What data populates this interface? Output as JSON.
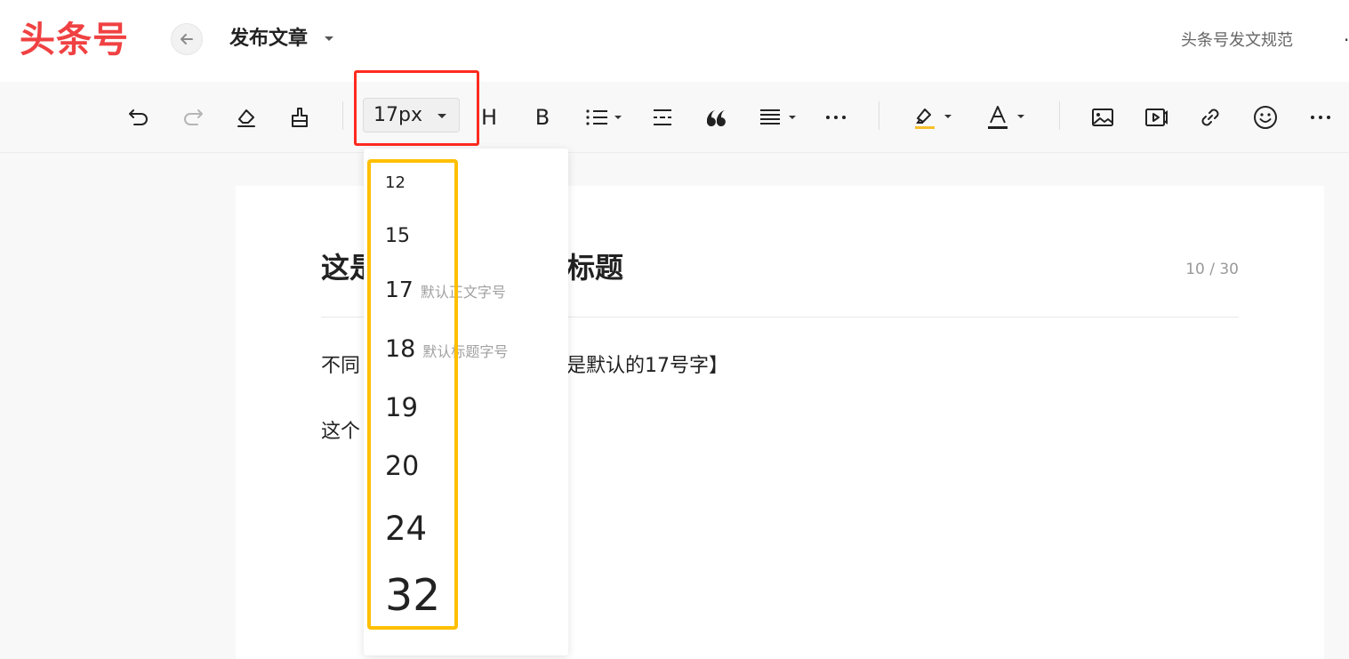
{
  "header": {
    "logo": "头条号",
    "title": "发布文章",
    "spec_link": "头条号发文规范",
    "more": "·"
  },
  "toolbar": {
    "font_size_value": "17px",
    "heading_label": "H",
    "bold_label": "B",
    "icons": [
      "undo-icon",
      "redo-icon",
      "eraser-icon",
      "format-painter-icon",
      "heading-icon",
      "bold-icon",
      "list-icon",
      "divider-icon",
      "quote-icon",
      "align-icon",
      "more-icon",
      "highlight-icon",
      "font-color-icon",
      "image-icon",
      "video-icon",
      "link-icon",
      "emoji-icon",
      "more-icon"
    ],
    "colors": {
      "highlight_underline": "#f7c02a",
      "font_color_underline": "#222222"
    }
  },
  "font_size_dropdown": {
    "items": [
      {
        "value": "12",
        "note": ""
      },
      {
        "value": "15",
        "note": ""
      },
      {
        "value": "17",
        "note": "默认正文字号"
      },
      {
        "value": "18",
        "note": "默认标题字号"
      },
      {
        "value": "19",
        "note": ""
      },
      {
        "value": "20",
        "note": ""
      },
      {
        "value": "24",
        "note": ""
      },
      {
        "value": "32",
        "note": ""
      }
    ]
  },
  "article": {
    "title_start": "这是",
    "title_end": "标题",
    "title_counter": "10 / 30",
    "paragraph1_start": "不同",
    "paragraph1_end": "是默认的17号字】",
    "paragraph2_start": "这个"
  },
  "colors": {
    "brand": "#f04142",
    "red_highlight": "#ff2a1f",
    "yellow_highlight": "#ffbf00"
  }
}
